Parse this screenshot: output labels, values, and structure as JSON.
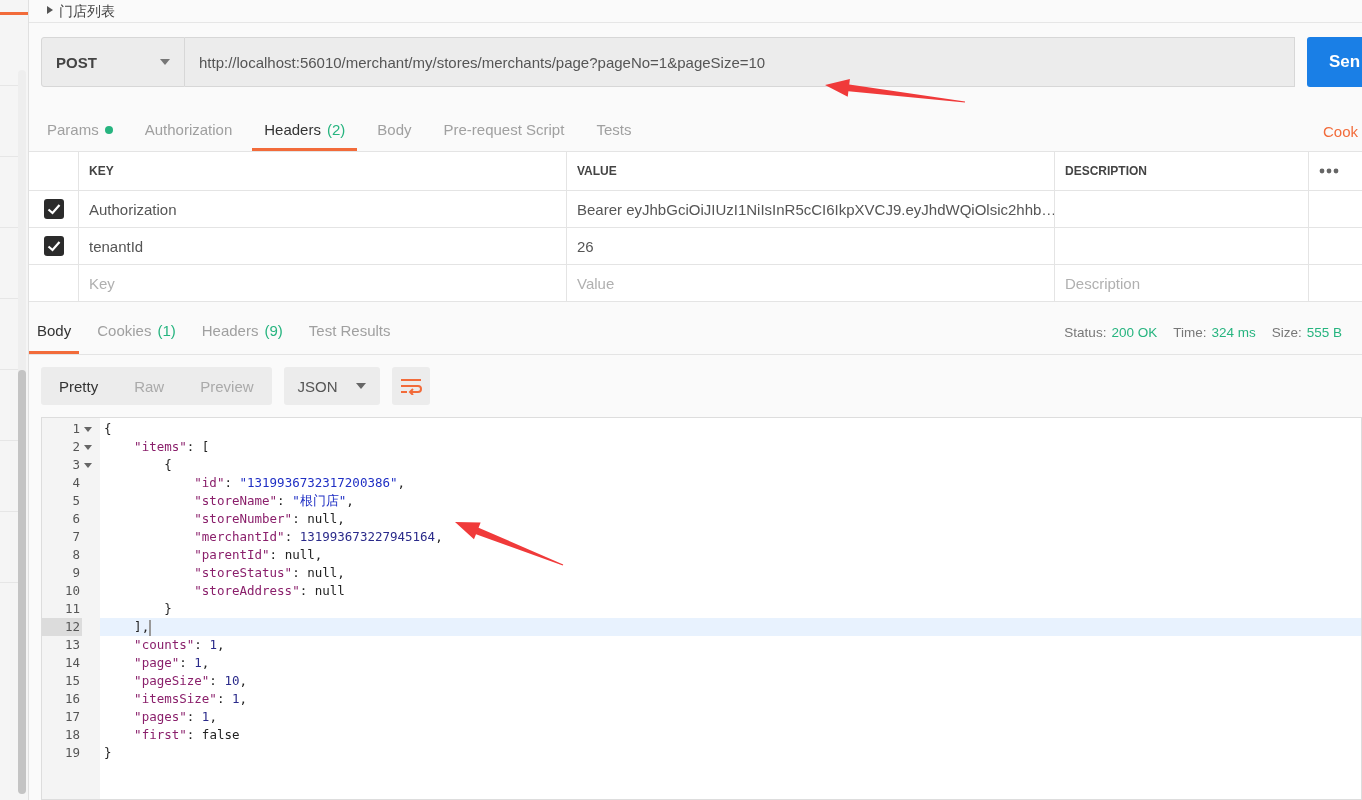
{
  "request_title": "门店列表",
  "request": {
    "method": "POST",
    "url": "http://localhost:56010/merchant/my/stores/merchants/page?pageNo=1&pageSize=10",
    "send_label": "Sen"
  },
  "request_tabs": [
    {
      "label": "Params",
      "selected": false,
      "dot": true
    },
    {
      "label": "Authorization",
      "selected": false
    },
    {
      "label": "Headers",
      "count": "(2)",
      "selected": true
    },
    {
      "label": "Body",
      "selected": false
    },
    {
      "label": "Pre-request Script",
      "selected": false
    },
    {
      "label": "Tests",
      "selected": false
    }
  ],
  "cookies_link": "Cook",
  "headers_table": {
    "columns": [
      "KEY",
      "VALUE",
      "DESCRIPTION"
    ],
    "rows": [
      {
        "checked": true,
        "key": "Authorization",
        "value": "Bearer eyJhbGciOiJIUzI1NiIsInR5cCI6IkpXVCJ9.eyJhdWQiOlsic2hhb…",
        "description": ""
      },
      {
        "checked": true,
        "key": "tenantId",
        "value": "26",
        "description": ""
      }
    ],
    "new_row": {
      "key_placeholder": "Key",
      "value_placeholder": "Value",
      "description_placeholder": "Description"
    }
  },
  "response_tabs": [
    {
      "label": "Body",
      "selected": true
    },
    {
      "label": "Cookies",
      "count": "(1)",
      "selected": false
    },
    {
      "label": "Headers",
      "count": "(9)",
      "selected": false
    },
    {
      "label": "Test Results",
      "selected": false
    }
  ],
  "status": [
    {
      "label": "Status:",
      "value": "200 OK"
    },
    {
      "label": "Time:",
      "value": "324 ms"
    },
    {
      "label": "Size:",
      "value": "555 B"
    }
  ],
  "view_modes": [
    {
      "label": "Pretty",
      "selected": true
    },
    {
      "label": "Raw",
      "selected": false
    },
    {
      "label": "Preview",
      "selected": false
    }
  ],
  "format": "JSON",
  "code_lines": [
    {
      "number": "1",
      "foldable": true,
      "active": false,
      "tokens": [
        {
          "kind": "punct",
          "text": "{"
        }
      ]
    },
    {
      "number": "2",
      "foldable": true,
      "active": false,
      "tokens": [
        {
          "kind": "key",
          "text": "    \"items\""
        },
        {
          "kind": "punct",
          "text": ": ["
        }
      ]
    },
    {
      "number": "3",
      "foldable": true,
      "active": false,
      "tokens": [
        {
          "kind": "punct",
          "text": "        {"
        }
      ]
    },
    {
      "number": "4",
      "foldable": false,
      "active": false,
      "tokens": [
        {
          "kind": "key",
          "text": "            \"id\""
        },
        {
          "kind": "punct",
          "text": ": "
        },
        {
          "kind": "string",
          "text": "\"1319936732317200386\""
        },
        {
          "kind": "punct",
          "text": ","
        }
      ]
    },
    {
      "number": "5",
      "foldable": false,
      "active": false,
      "tokens": [
        {
          "kind": "key",
          "text": "            \"storeName\""
        },
        {
          "kind": "punct",
          "text": ": "
        },
        {
          "kind": "string",
          "text": "\"根门店\""
        },
        {
          "kind": "punct",
          "text": ","
        }
      ]
    },
    {
      "number": "6",
      "foldable": false,
      "active": false,
      "tokens": [
        {
          "kind": "key",
          "text": "            \"storeNumber\""
        },
        {
          "kind": "punct",
          "text": ": "
        },
        {
          "kind": "literal",
          "text": "null"
        },
        {
          "kind": "punct",
          "text": ","
        }
      ]
    },
    {
      "number": "7",
      "foldable": false,
      "active": false,
      "tokens": [
        {
          "kind": "key",
          "text": "            \"merchantId\""
        },
        {
          "kind": "punct",
          "text": ": "
        },
        {
          "kind": "number",
          "text": "131993673227945164"
        },
        {
          "kind": "punct",
          "text": ","
        }
      ]
    },
    {
      "number": "8",
      "foldable": false,
      "active": false,
      "tokens": [
        {
          "kind": "key",
          "text": "            \"parentId\""
        },
        {
          "kind": "punct",
          "text": ": "
        },
        {
          "kind": "literal",
          "text": "null"
        },
        {
          "kind": "punct",
          "text": ","
        }
      ]
    },
    {
      "number": "9",
      "foldable": false,
      "active": false,
      "tokens": [
        {
          "kind": "key",
          "text": "            \"storeStatus\""
        },
        {
          "kind": "punct",
          "text": ": "
        },
        {
          "kind": "literal",
          "text": "null"
        },
        {
          "kind": "punct",
          "text": ","
        }
      ]
    },
    {
      "number": "10",
      "foldable": false,
      "active": false,
      "tokens": [
        {
          "kind": "key",
          "text": "            \"storeAddress\""
        },
        {
          "kind": "punct",
          "text": ": "
        },
        {
          "kind": "literal",
          "text": "null"
        }
      ]
    },
    {
      "number": "11",
      "foldable": false,
      "active": false,
      "tokens": [
        {
          "kind": "punct",
          "text": "        }"
        }
      ]
    },
    {
      "number": "12",
      "foldable": false,
      "active": true,
      "tokens": [
        {
          "kind": "punct",
          "text": "    ],"
        }
      ]
    },
    {
      "number": "13",
      "foldable": false,
      "active": false,
      "tokens": [
        {
          "kind": "key",
          "text": "    \"counts\""
        },
        {
          "kind": "punct",
          "text": ": "
        },
        {
          "kind": "number",
          "text": "1"
        },
        {
          "kind": "punct",
          "text": ","
        }
      ]
    },
    {
      "number": "14",
      "foldable": false,
      "active": false,
      "tokens": [
        {
          "kind": "key",
          "text": "    \"page\""
        },
        {
          "kind": "punct",
          "text": ": "
        },
        {
          "kind": "number",
          "text": "1"
        },
        {
          "kind": "punct",
          "text": ","
        }
      ]
    },
    {
      "number": "15",
      "foldable": false,
      "active": false,
      "tokens": [
        {
          "kind": "key",
          "text": "    \"pageSize\""
        },
        {
          "kind": "punct",
          "text": ": "
        },
        {
          "kind": "number",
          "text": "10"
        },
        {
          "kind": "punct",
          "text": ","
        }
      ]
    },
    {
      "number": "16",
      "foldable": false,
      "active": false,
      "tokens": [
        {
          "kind": "key",
          "text": "    \"itemsSize\""
        },
        {
          "kind": "punct",
          "text": ": "
        },
        {
          "kind": "number",
          "text": "1"
        },
        {
          "kind": "punct",
          "text": ","
        }
      ]
    },
    {
      "number": "17",
      "foldable": false,
      "active": false,
      "tokens": [
        {
          "kind": "key",
          "text": "    \"pages\""
        },
        {
          "kind": "punct",
          "text": ": "
        },
        {
          "kind": "number",
          "text": "1"
        },
        {
          "kind": "punct",
          "text": ","
        }
      ]
    },
    {
      "number": "18",
      "foldable": false,
      "active": false,
      "tokens": [
        {
          "kind": "key",
          "text": "    \"first\""
        },
        {
          "kind": "punct",
          "text": ": "
        },
        {
          "kind": "literal",
          "text": "false"
        }
      ]
    },
    {
      "number": "19",
      "foldable": false,
      "active": false,
      "tokens": [
        {
          "kind": "punct",
          "text": "}"
        }
      ]
    }
  ]
}
